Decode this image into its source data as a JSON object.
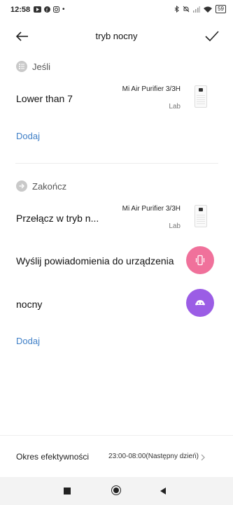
{
  "status_bar": {
    "time": "12:58",
    "battery": "59"
  },
  "header": {
    "title": "tryb nocny"
  },
  "if_section": {
    "label": "Jeśli",
    "condition": "Lower than 7",
    "device_name": "Mi Air Purifier 3/3H",
    "device_room": "Lab",
    "add_label": "Dodaj"
  },
  "then_section": {
    "label": "Zakończ",
    "actions": [
      {
        "title": "Przełącz w tryb n...",
        "device_name": "Mi Air Purifier 3/3H",
        "device_room": "Lab"
      },
      {
        "title": "Wyślij powiadomienia do urządzenia",
        "icon": "phone-vibrate-icon",
        "color": "#f0719b"
      },
      {
        "title": "nocny",
        "icon": "robot-icon",
        "color": "#9b5de5"
      }
    ],
    "add_label": "Dodaj"
  },
  "footer": {
    "label": "Okres efektywności",
    "value": "23:00-08:00(Następny dzień)"
  },
  "colors": {
    "accent_link": "#3f7fc7",
    "pink": "#f0719b",
    "purple": "#9b5de5"
  }
}
